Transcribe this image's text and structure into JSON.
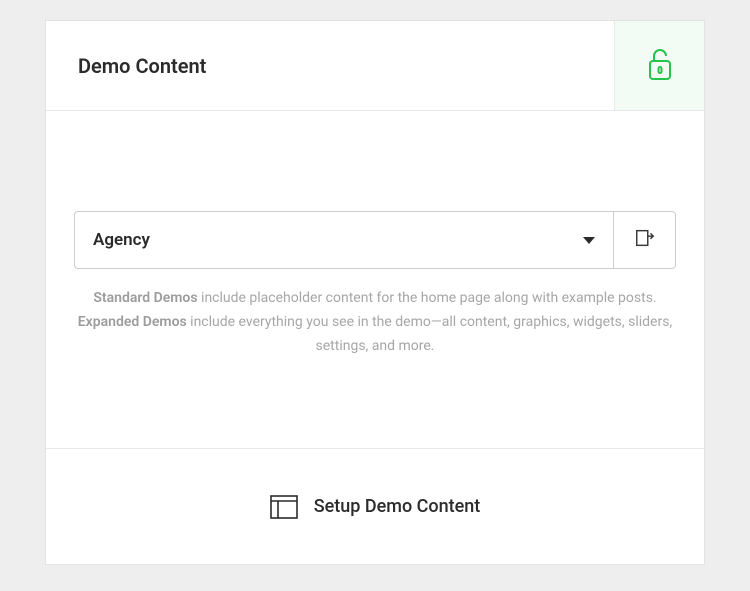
{
  "header": {
    "title": "Demo Content"
  },
  "body": {
    "select": {
      "value": "Agency"
    },
    "description": {
      "strong1": "Standard Demos",
      "part1": " include placeholder content for the home page along with example posts. ",
      "strong2": "Expanded Demos",
      "part2": " include everything you see in the demo—all content, graphics, widgets, sliders, settings, and more."
    }
  },
  "footer": {
    "action": "Setup Demo Content"
  }
}
